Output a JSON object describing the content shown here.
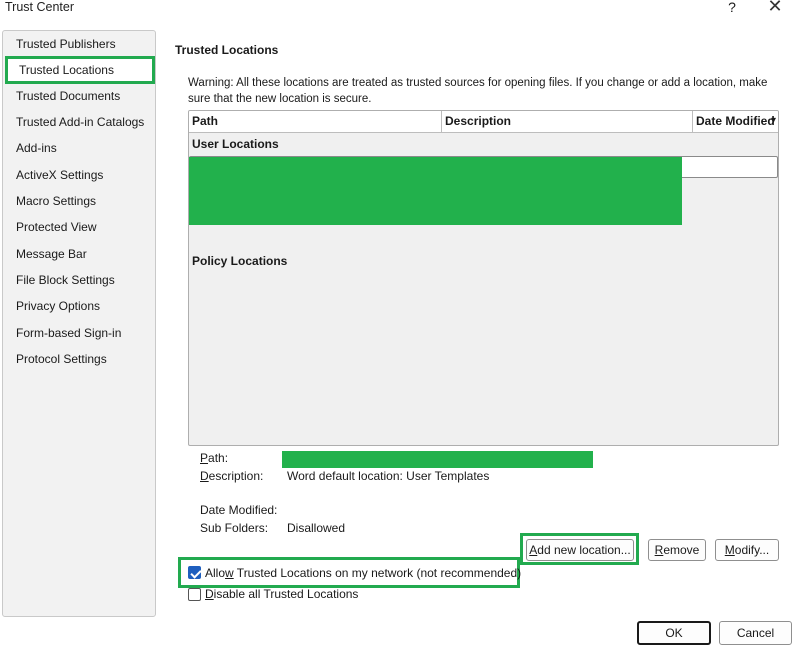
{
  "window": {
    "title": "Trust Center",
    "help_glyph": "?",
    "close_glyph": "✕"
  },
  "sidebar": {
    "items": [
      {
        "label": "Trusted Publishers"
      },
      {
        "label": "Trusted Locations",
        "selected": true
      },
      {
        "label": "Trusted Documents"
      },
      {
        "label": "Trusted Add-in Catalogs"
      },
      {
        "label": "Add-ins"
      },
      {
        "label": "ActiveX Settings"
      },
      {
        "label": "Macro Settings"
      },
      {
        "label": "Protected View"
      },
      {
        "label": "Message Bar"
      },
      {
        "label": "File Block Settings"
      },
      {
        "label": "Privacy Options"
      },
      {
        "label": "Form-based Sign-in"
      },
      {
        "label": "Protocol Settings"
      }
    ]
  },
  "main": {
    "section_title": "Trusted Locations",
    "warning": "Warning: All these locations are treated as trusted sources for opening files.  If you change or add a location, make sure that the new location is secure.",
    "table": {
      "columns": [
        "Path",
        "Description",
        "Date Modified"
      ],
      "sort_glyph": "▾",
      "groups": [
        "User Locations",
        "Policy Locations"
      ]
    },
    "details": {
      "path_label": "Path:",
      "path_label_accel": "P",
      "path_label_rest": "ath:",
      "description_label_accel": "D",
      "description_label_rest": "escription:",
      "description_value": "Word default location: User Templates",
      "date_modified_label": "Date Modified:",
      "sub_folders_label": "Sub Folders:",
      "sub_folders_value": "Disallowed"
    },
    "buttons": {
      "add_accel": "A",
      "add_rest": "dd new location...",
      "remove_accel": "R",
      "remove_rest": "emove",
      "modify_accel": "M",
      "modify_rest": "odify..."
    },
    "checkboxes": {
      "allow_network_pre": "Allo",
      "allow_network_accel": "w",
      "allow_network_post": " Trusted Locations on my network (not recommended)",
      "allow_network_checked": true,
      "disable_all_accel": "D",
      "disable_all_rest": "isable all Trusted Locations",
      "disable_all_checked": false
    }
  },
  "footer": {
    "ok_label": "OK",
    "cancel_label": "Cancel"
  },
  "colors": {
    "highlight_green": "#22aa4f",
    "redaction_green": "#22b14c",
    "checkbox_blue": "#1f5fbf"
  }
}
